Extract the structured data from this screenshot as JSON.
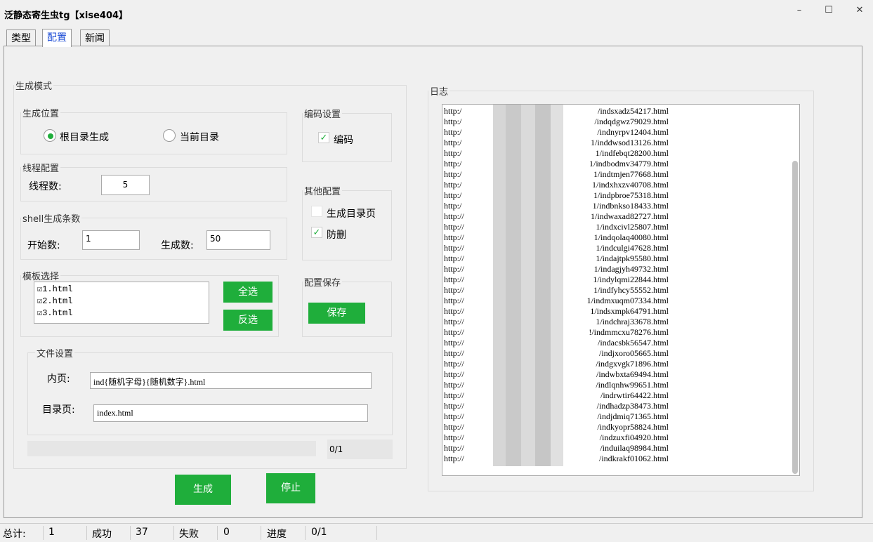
{
  "window": {
    "title": "泛静态寄生虫tg【xise404】",
    "minimize": "–",
    "maximize": "☐",
    "close": "✕"
  },
  "tabs": [
    {
      "label": "类型",
      "active": false
    },
    {
      "label": "配置",
      "active": true
    },
    {
      "label": "新闻",
      "active": false
    }
  ],
  "generate_mode": {
    "title": "生成模式",
    "location": {
      "title": "生成位置",
      "options": [
        {
          "label": "根目录生成",
          "selected": true
        },
        {
          "label": "当前目录",
          "selected": false
        }
      ]
    },
    "thread": {
      "title": "线程配置",
      "label": "线程数:",
      "value": "5"
    },
    "shell": {
      "title": "shell生成条数",
      "start_label": "开始数:",
      "start_value": "1",
      "count_label": "生成数:",
      "count_value": "50"
    },
    "template": {
      "title": "模板选择",
      "items": [
        {
          "label": "1.html",
          "checked": true
        },
        {
          "label": "2.html",
          "checked": true
        },
        {
          "label": "3.html",
          "checked": true
        }
      ],
      "select_all": "全选",
      "invert": "反选"
    },
    "encoding": {
      "title": "编码设置",
      "label": "编码",
      "checked": true
    },
    "other": {
      "title": "其他配置",
      "gen_index_label": "生成目录页",
      "gen_index_checked": false,
      "anti_delete_label": "防删",
      "anti_delete_checked": true
    },
    "save_config": {
      "title": "配置保存",
      "button": "保存"
    },
    "file": {
      "title": "文件设置",
      "inner_label": "内页:",
      "inner_value": "ind{随机字母}{随机数字}.html",
      "index_label": "目录页:",
      "index_value": "index.html"
    },
    "progress": {
      "text": "0/1",
      "fraction": 0
    }
  },
  "buttons": {
    "generate": "生成",
    "stop": "停止"
  },
  "log": {
    "title": "日志",
    "lines": [
      {
        "prefix": "http:/",
        "suffix": "/indsxadz54217.html"
      },
      {
        "prefix": "http:/",
        "suffix": "/indqdgwz79029.html"
      },
      {
        "prefix": "http:/",
        "suffix": "/indnyrpv12404.html"
      },
      {
        "prefix": "http:/",
        "suffix": "1/inddwsod13126.html"
      },
      {
        "prefix": "http:/",
        "suffix": "1/indfebqt28200.html"
      },
      {
        "prefix": "http:/",
        "suffix": "1/indbodmv34779.html"
      },
      {
        "prefix": "http:/",
        "suffix": "1/indtmjen77668.html"
      },
      {
        "prefix": "http:/",
        "suffix": "1/indxhxzv40708.html"
      },
      {
        "prefix": "http:/",
        "suffix": "1/indpbroe75318.html"
      },
      {
        "prefix": "http:/",
        "suffix": "1/indbnkso18433.html"
      },
      {
        "prefix": "http://",
        "suffix": "1/indwaxad82727.html"
      },
      {
        "prefix": "http://",
        "suffix": "1/indxcivl25807.html"
      },
      {
        "prefix": "http://",
        "suffix": "1/indqolaq40080.html"
      },
      {
        "prefix": "http://",
        "suffix": "1/indculgi47628.html"
      },
      {
        "prefix": "http://",
        "suffix": "1/indajtpk95580.html"
      },
      {
        "prefix": "http://",
        "suffix": "1/indagjyh49732.html"
      },
      {
        "prefix": "http://",
        "suffix": "1/indylqmi22844.html"
      },
      {
        "prefix": "http://",
        "suffix": "1/indfyhcy55552.html"
      },
      {
        "prefix": "http://",
        "suffix": "1/indmxuqm07334.html"
      },
      {
        "prefix": "http://",
        "suffix": "1/indsxmpk64791.html"
      },
      {
        "prefix": "http://",
        "suffix": "1/indchraj33678.html"
      },
      {
        "prefix": "http://",
        "suffix": "!/indmmcxu78276.html"
      },
      {
        "prefix": "http://",
        "suffix": "/indacsbk56547.html"
      },
      {
        "prefix": "http://",
        "suffix": "/indjxoro05665.html"
      },
      {
        "prefix": "http://",
        "suffix": "/indgxvgk71896.html"
      },
      {
        "prefix": "http://",
        "suffix": "/indwbxta69494.html"
      },
      {
        "prefix": "http://",
        "suffix": "/indlqnhw99651.html"
      },
      {
        "prefix": "http://",
        "suffix": "/indrwtir64422.html"
      },
      {
        "prefix": "http://",
        "suffix": "/indhadzp38473.html"
      },
      {
        "prefix": "http://",
        "suffix": "/indjdmiq71365.html"
      },
      {
        "prefix": "http://",
        "suffix": "/indkyopr58824.html"
      },
      {
        "prefix": "http://",
        "suffix": "/indzuxfi04920.html"
      },
      {
        "prefix": "http://",
        "suffix": "/induilaq98984.html"
      },
      {
        "prefix": "http://",
        "suffix": "/indkrakf01062.html"
      }
    ]
  },
  "status": {
    "total_label": "总计:",
    "total_value": "1",
    "success_label": "成功",
    "success_value": "37",
    "fail_label": "失败",
    "fail_value": "0",
    "progress_label": "进度",
    "progress_value": "0/1"
  },
  "colors": {
    "accent_green": "#1fae3b",
    "active_tab": "#1a4bd6"
  }
}
